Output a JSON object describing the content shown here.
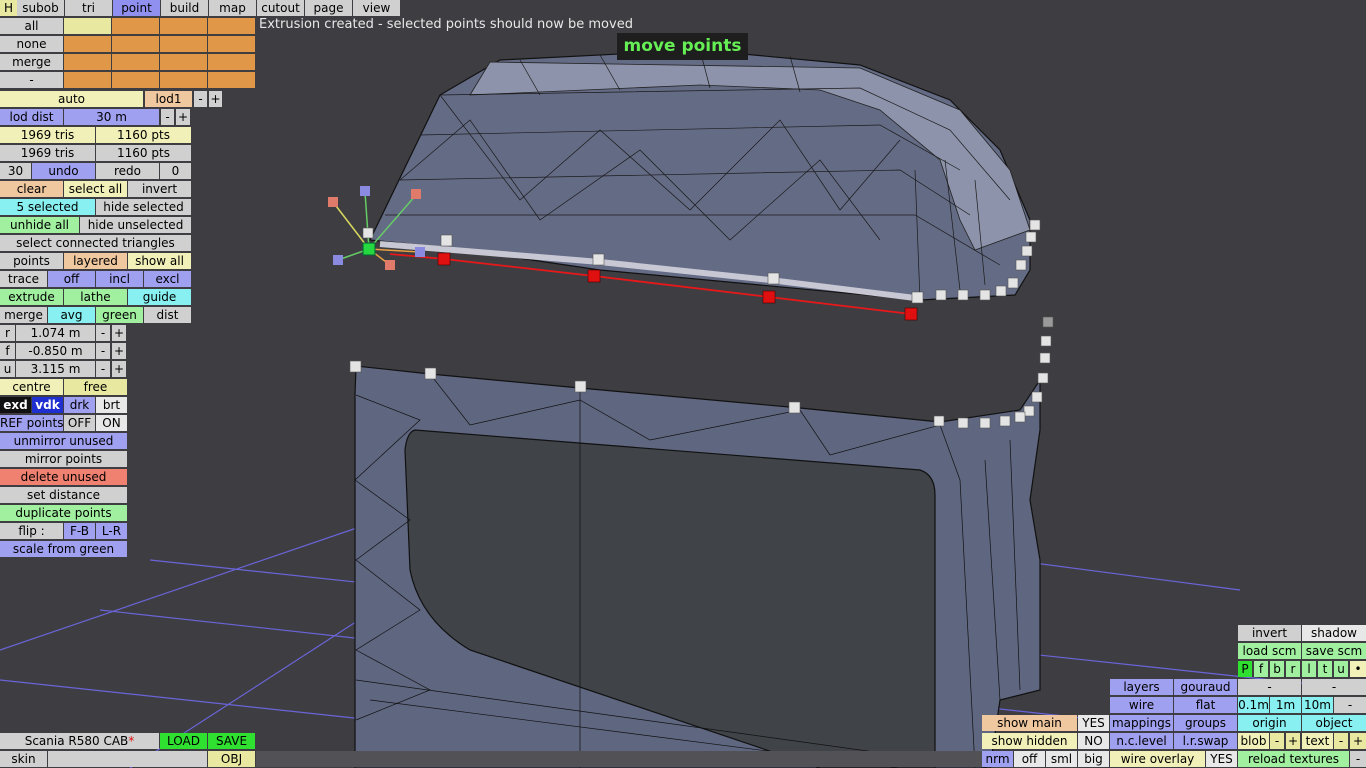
{
  "status_message": "Extrusion created - selected points should now be moved",
  "mode_banner": "move points",
  "menu": [
    "H",
    "subob",
    "tri",
    "point",
    "build",
    "map",
    "cutout",
    "page",
    "view"
  ],
  "sel": {
    "all": "all",
    "none": "none",
    "merge": "merge",
    "minus": "-"
  },
  "lod": {
    "auto": "auto",
    "lod1": "lod1",
    "minus": "-",
    "plus": "+",
    "dist_label": "lod dist",
    "dist_value": "30 m",
    "tris1": "1969 tris",
    "pts1": "1160 pts",
    "tris2": "1969 tris",
    "pts2": "1160 pts"
  },
  "undo": {
    "count": "30",
    "undo": "undo",
    "redo": "redo",
    "redo_count": "0"
  },
  "select": {
    "clear": "clear",
    "select_all": "select all",
    "invert": "invert",
    "selected": "5 selected",
    "hide_selected": "hide selected",
    "unhide_all": "unhide all",
    "hide_unselected": "hide unselected",
    "select_connected": "select connected triangles"
  },
  "points": {
    "points": "points",
    "layered": "layered",
    "show_all": "show all",
    "trace": "trace",
    "off": "off",
    "incl": "incl",
    "excl": "excl",
    "extrude": "extrude",
    "lathe": "lathe",
    "guide": "guide",
    "merge": "merge",
    "avg": "avg",
    "green": "green",
    "dist": "dist"
  },
  "coords": [
    {
      "axis": "r",
      "value": "1.074 m"
    },
    {
      "axis": "f",
      "value": "-0.850 m"
    },
    {
      "axis": "u",
      "value": "3.115 m"
    }
  ],
  "pivot": {
    "centre": "centre",
    "free": "free"
  },
  "shade": {
    "exd": "exd",
    "vdk": "vdk",
    "drk": "drk",
    "brt": "brt"
  },
  "ref": {
    "label": "REF points",
    "off": "OFF",
    "on": "ON"
  },
  "actions": {
    "unmirror": "unmirror unused",
    "mirror": "mirror points",
    "delete_unused": "delete unused",
    "set_distance": "set distance",
    "duplicate": "duplicate points",
    "flip": "flip :",
    "fb": "F-B",
    "lr": "L-R",
    "scale": "scale from green"
  },
  "file": {
    "name": "Scania R580 CAB",
    "modified": "*",
    "load": "LOAD",
    "save": "SAVE",
    "skin": "skin",
    "obj": "OBJ"
  },
  "rp": {
    "invert": "invert",
    "shadow": "shadow",
    "load_scm": "load scm",
    "save_scm": "save scm",
    "letters": [
      "P",
      "f",
      "b",
      "r",
      "l",
      "t",
      "u",
      "•"
    ],
    "layers": "layers",
    "gouraud": "gouraud",
    "wire": "wire",
    "flat": "flat",
    "mappings": "mappings",
    "groups": "groups",
    "nc_level": "n.c.level",
    "lr_swap": "l.r.swap",
    "wire_overlay": "wire overlay",
    "yes": "YES",
    "show_main": "show main",
    "show_hidden": "show hidden",
    "no": "NO",
    "nrm": "nrm",
    "off": "off",
    "sml": "sml",
    "big": "big",
    "minus": "-",
    "plus": "+",
    "d01": "0.1m",
    "d1": "1m",
    "d10": "10m",
    "origin": "origin",
    "object": "object",
    "blob": "blob",
    "text": "text",
    "reload": "reload textures"
  }
}
